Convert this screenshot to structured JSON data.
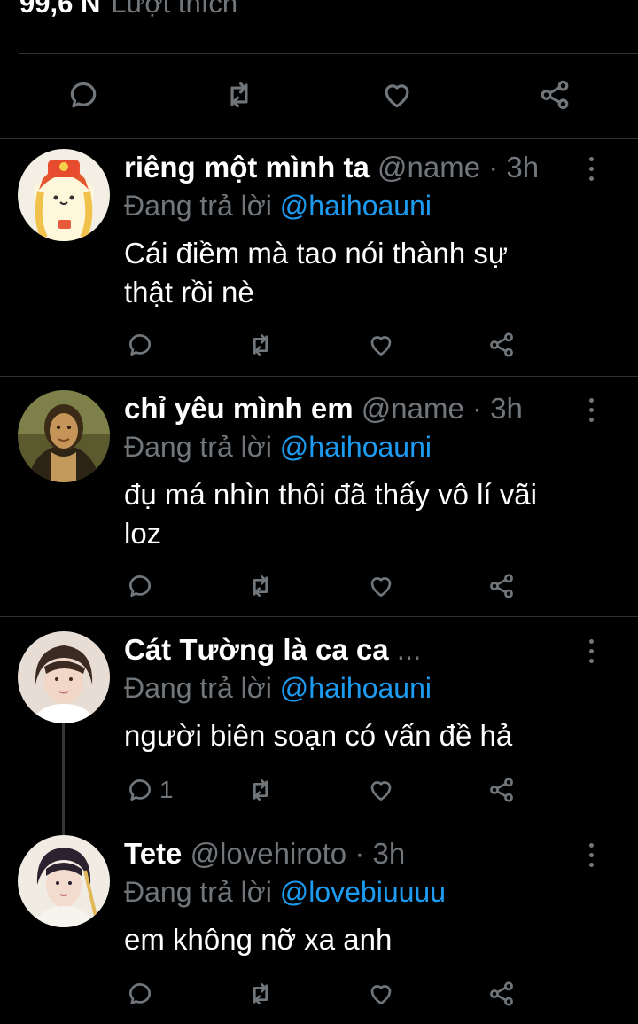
{
  "header": {
    "likes_count": "99,6 N",
    "likes_label": "Lượt thích"
  },
  "main_actions": [
    "reply-icon",
    "retweet-icon",
    "like-icon",
    "share-icon"
  ],
  "tweets": [
    {
      "name": "riêng một mình ta",
      "handle": "@name",
      "time": "3h",
      "replying_prefix": "Đang trả lời",
      "replying_to": "@haihoauni",
      "text_lines": [
        "Cái điềm mà tao nói thành sự",
        "thật rồi nè"
      ],
      "reply_count": ""
    },
    {
      "name": "chỉ yêu mình em",
      "handle": "@name",
      "time": "3h",
      "replying_prefix": "Đang trả lời",
      "replying_to": "@haihoauni",
      "text_lines": [
        "đụ má nhìn thôi đã thấy vô lí vãi",
        "loz"
      ],
      "reply_count": ""
    },
    {
      "name": "Cát Tường là ca ca",
      "handle_truncated": "...",
      "replying_prefix": "Đang trả lời",
      "replying_to": "@haihoauni",
      "text_lines": [
        "người biên soạn có vấn đề hả"
      ],
      "reply_count": "1"
    },
    {
      "name": "Tete",
      "handle": "@lovehiroto",
      "time": "3h",
      "replying_prefix": "Đang trả lời",
      "replying_to": "@lovebiuuuu",
      "text_lines": [
        "em không nỡ xa anh"
      ],
      "reply_count": ""
    }
  ],
  "colors": {
    "background": "#000000",
    "text": "#ffffff",
    "muted": "#71767b",
    "link": "#1d9bf0",
    "divider": "#2f3336"
  }
}
